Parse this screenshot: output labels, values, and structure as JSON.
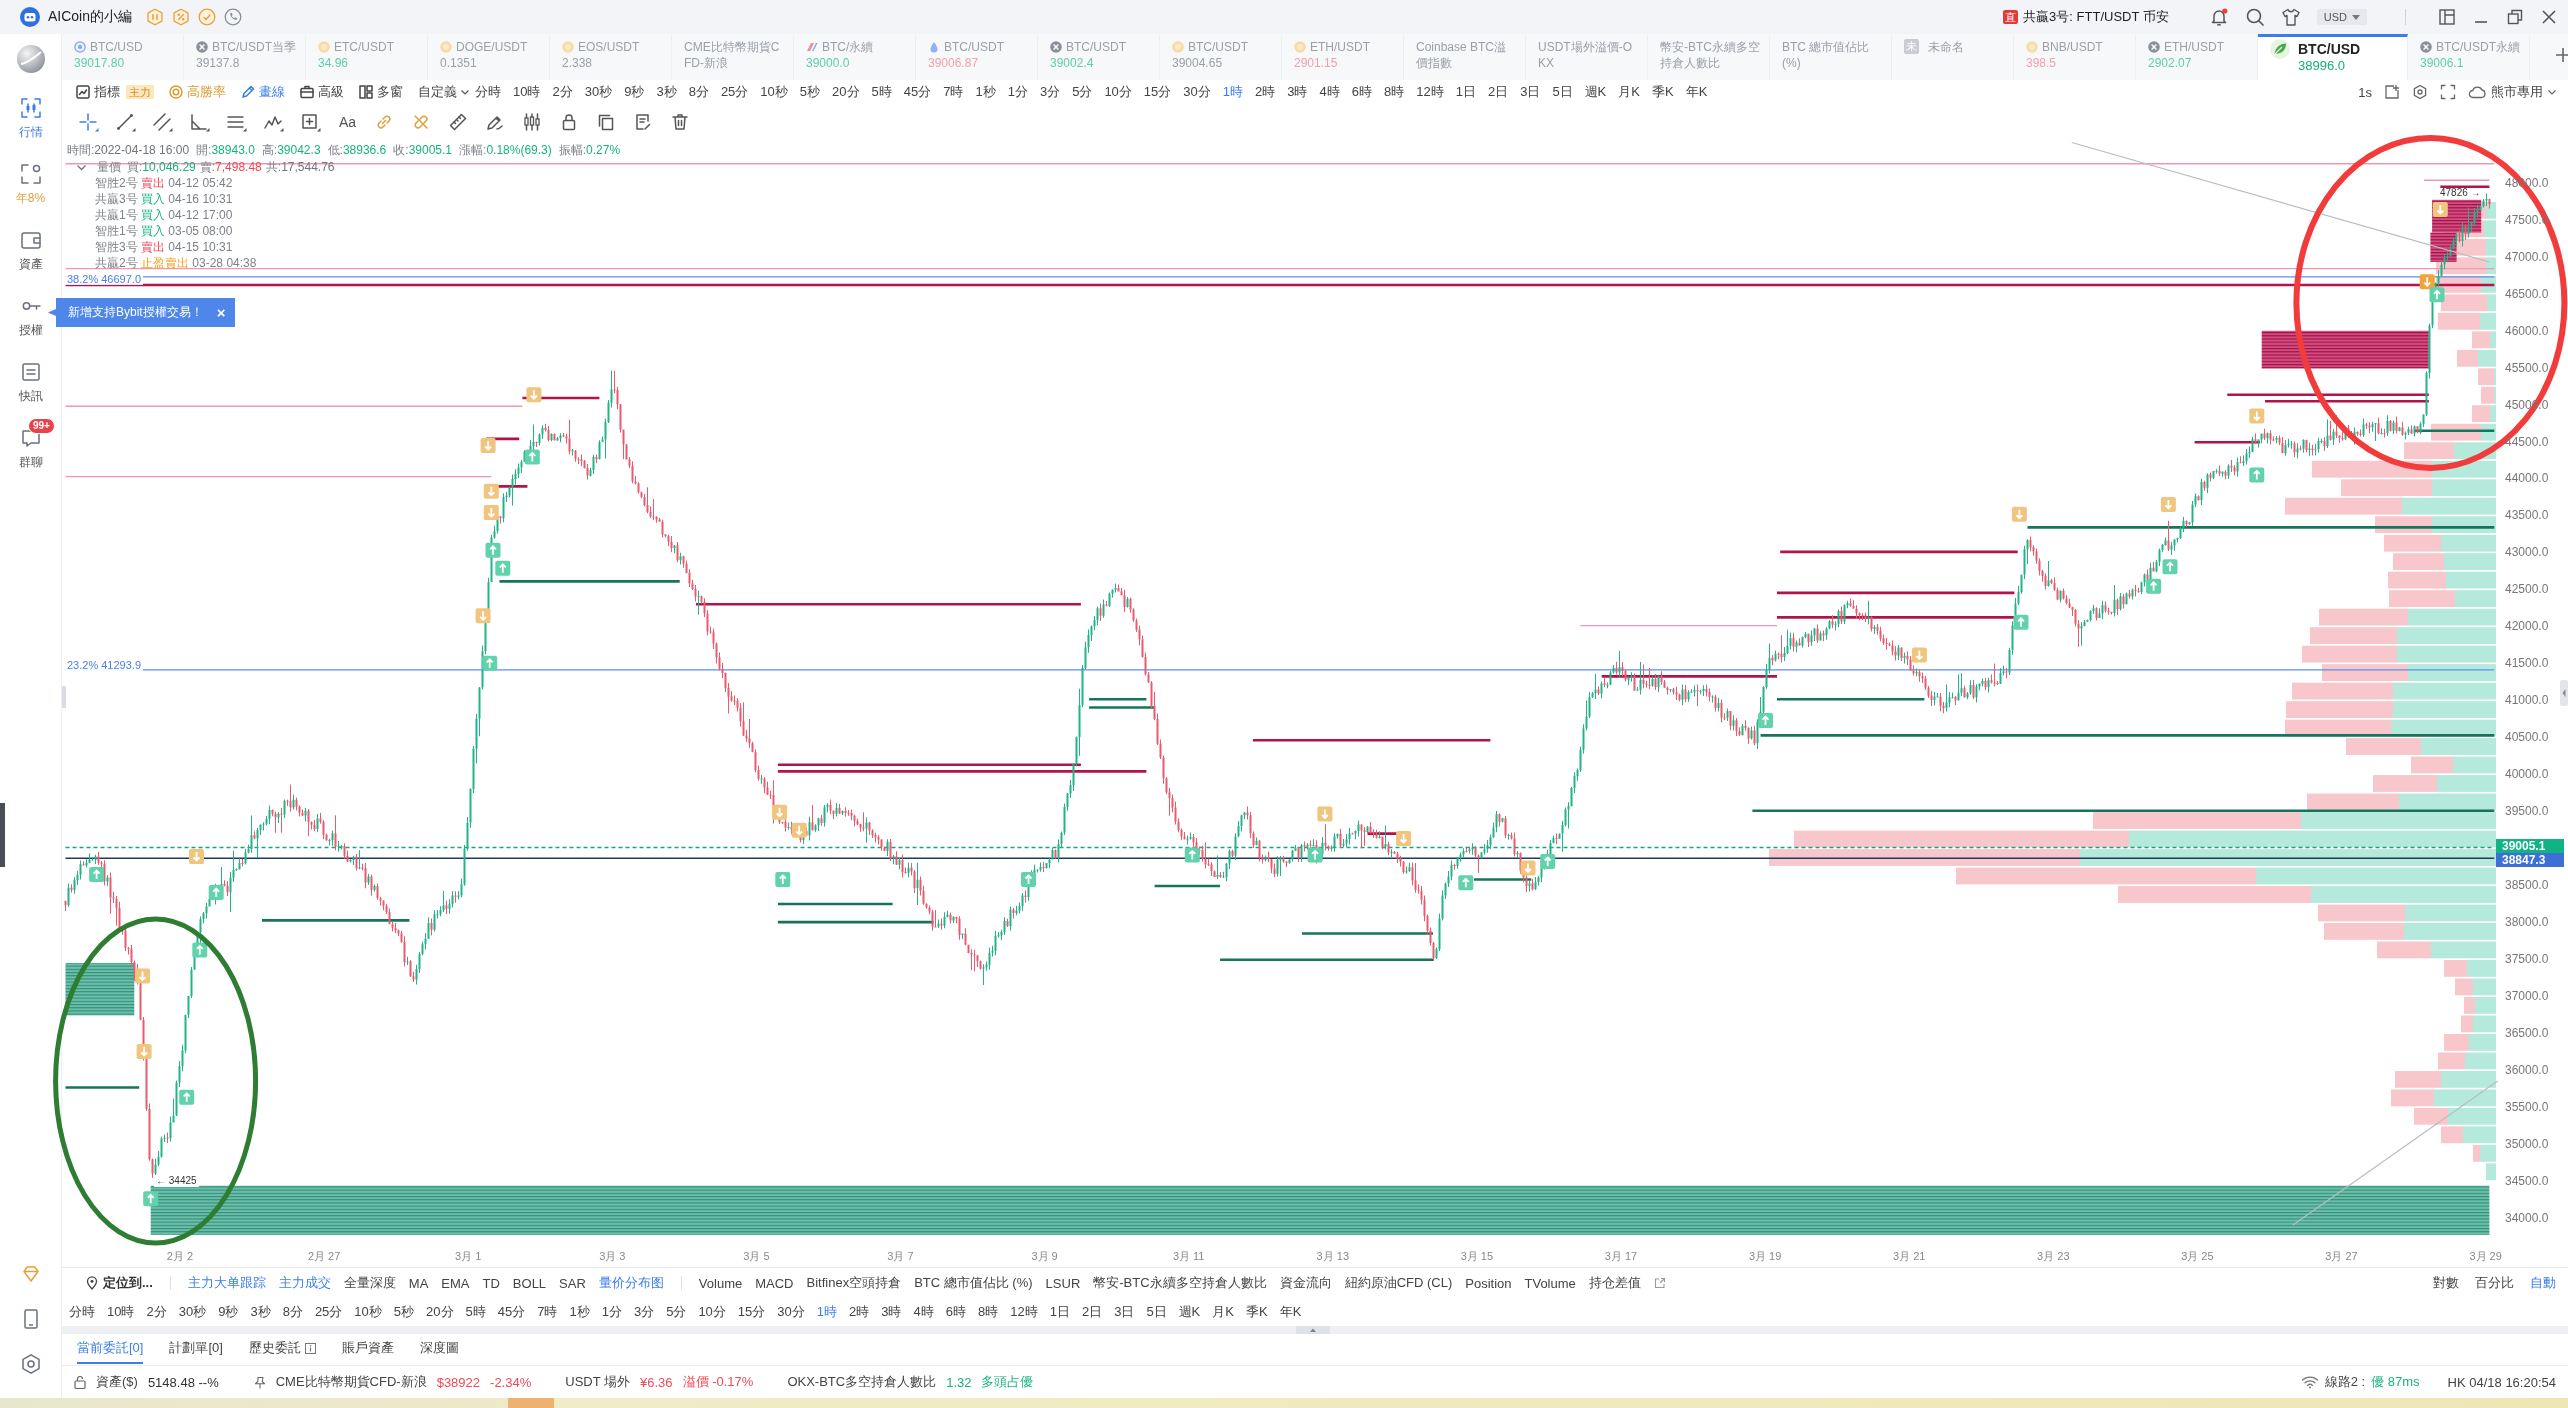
{
  "window": {
    "title": "AICoin的小編",
    "alert": {
      "tag": "直",
      "text": "共贏3号: FTT/USDT 币安"
    },
    "unread": true,
    "currency": "USD"
  },
  "sidebar": {
    "items": [
      {
        "label": "行情",
        "kind": "market",
        "selected": true
      },
      {
        "label": "年8%",
        "kind": "earn",
        "selected": false
      },
      {
        "label": "資產",
        "kind": "assets",
        "selected": false
      },
      {
        "label": "授權",
        "kind": "auth",
        "selected": false
      },
      {
        "label": "快訊",
        "kind": "news",
        "selected": false
      },
      {
        "label": "群聊",
        "kind": "chat",
        "selected": false,
        "badge": "99+"
      }
    ]
  },
  "ticker_tabs": [
    {
      "kind": "ring",
      "name": "BTC/USD",
      "price": "39017.80",
      "color": "#5ccfa6",
      "selected": false
    },
    {
      "kind": "gear",
      "name": "BTC/USDT当季",
      "price": "39137.8",
      "color": "#9a9fa8",
      "selected": false
    },
    {
      "kind": "coin",
      "name": "ETC/USDT",
      "price": "34.96",
      "color": "#5ccfa6",
      "selected": false
    },
    {
      "kind": "coin",
      "name": "DOGE/USDT",
      "price": "0.1351",
      "color": "#9a9fa8",
      "selected": false
    },
    {
      "kind": "coin",
      "name": "EOS/USDT",
      "price": "2.338",
      "color": "#9a9fa8",
      "selected": false
    },
    {
      "kind": "plain",
      "name": "CME比特幣期貨CFD-新浪",
      "selected": false
    },
    {
      "kind": "flag",
      "name": "BTC/永續",
      "price": "39000.0",
      "color": "#5ccfa6",
      "selected": false
    },
    {
      "kind": "drop",
      "name": "BTC/USDT",
      "price": "39006.87",
      "color": "#f3a0a8",
      "selected": false
    },
    {
      "kind": "gear",
      "name": "BTC/USDT",
      "price": "39002.4",
      "color": "#5ccfa6",
      "selected": false
    },
    {
      "kind": "coin",
      "name": "BTC/USDT",
      "price": "39004.65",
      "color": "#9a9fa8",
      "selected": false
    },
    {
      "kind": "coin",
      "name": "ETH/USDT",
      "price": "2901.15",
      "color": "#f3a0a8",
      "selected": false
    },
    {
      "kind": "plain",
      "name": "Coinbase BTC溢價指數",
      "selected": false
    },
    {
      "kind": "plain",
      "name": "USDT場外溢價-OKX",
      "selected": false
    },
    {
      "kind": "plain",
      "name": "幣安-BTC永續多空持倉人數比",
      "selected": false
    },
    {
      "kind": "plain",
      "name": "BTC 總市值佔比 (%)",
      "selected": false
    },
    {
      "kind": "label",
      "badge": "未",
      "name": "未命名",
      "selected": false
    },
    {
      "kind": "coin",
      "name": "BNB/USDT",
      "price": "398.5",
      "color": "#f3a0a8",
      "selected": false
    },
    {
      "kind": "gear",
      "name": "ETH/USDT",
      "price": "2902.07",
      "color": "#5ccfa6",
      "selected": false
    },
    {
      "kind": "leaf",
      "name": "BTC/USD",
      "price": "38996.0",
      "color": "#14ad7c",
      "selected": true
    },
    {
      "kind": "gear",
      "name": "BTC/USDT永續",
      "price": "39006.1",
      "color": "#5ccfa6",
      "selected": false
    }
  ],
  "toolbar": {
    "tools": [
      {
        "kind": "indicators",
        "label": "指標",
        "tag": "主力",
        "active": false
      },
      {
        "kind": "winrate",
        "label": "高勝率",
        "active": false
      },
      {
        "kind": "draw",
        "label": "畫線",
        "active": true
      },
      {
        "kind": "advanced",
        "label": "高級",
        "active": false
      },
      {
        "kind": "windows",
        "label": "多窗",
        "active": false
      },
      {
        "kind": "custom",
        "label": "自定義",
        "active": false
      }
    ],
    "intervals": [
      {
        "label": "分時",
        "selected": false
      },
      {
        "label": "10時",
        "selected": false
      },
      {
        "label": "2分",
        "selected": false
      },
      {
        "label": "30秒",
        "selected": false
      },
      {
        "label": "9秒",
        "selected": false
      },
      {
        "label": "3秒",
        "selected": false
      },
      {
        "label": "8分",
        "selected": false
      },
      {
        "label": "25分",
        "selected": false
      },
      {
        "label": "10秒",
        "selected": false
      },
      {
        "label": "5秒",
        "selected": false
      },
      {
        "label": "20分",
        "selected": false
      },
      {
        "label": "5時",
        "selected": false
      },
      {
        "label": "45分",
        "selected": false
      },
      {
        "label": "7時",
        "selected": false
      },
      {
        "label": "1秒",
        "selected": false
      },
      {
        "label": "1分",
        "selected": false
      },
      {
        "label": "3分",
        "selected": false
      },
      {
        "label": "5分",
        "selected": false
      },
      {
        "label": "10分",
        "selected": false
      },
      {
        "label": "15分",
        "selected": false
      },
      {
        "label": "30分",
        "selected": false
      },
      {
        "label": "1時",
        "selected": true
      },
      {
        "label": "2時",
        "selected": false
      },
      {
        "label": "3時",
        "selected": false
      },
      {
        "label": "4時",
        "selected": false
      },
      {
        "label": "6時",
        "selected": false
      },
      {
        "label": "8時",
        "selected": false
      },
      {
        "label": "12時",
        "selected": false
      },
      {
        "label": "1日",
        "selected": false
      },
      {
        "label": "2日",
        "selected": false
      },
      {
        "label": "3日",
        "selected": false
      },
      {
        "label": "5日",
        "selected": false
      },
      {
        "label": "週K",
        "selected": false
      },
      {
        "label": "月K",
        "selected": false
      },
      {
        "label": "季K",
        "selected": false
      },
      {
        "label": "年K",
        "selected": false
      }
    ],
    "refresh": "1s",
    "theme": "熊市專用"
  },
  "drawing_tools": [
    {
      "kind": "crosshair",
      "selected": true
    },
    {
      "kind": "segment",
      "selected": false
    },
    {
      "kind": "parallel",
      "selected": false
    },
    {
      "kind": "angle",
      "selected": false
    },
    {
      "kind": "hlines",
      "selected": false
    },
    {
      "kind": "wave",
      "selected": false
    },
    {
      "kind": "box",
      "selected": false
    },
    {
      "kind": "text",
      "label": "Aa",
      "selected": false
    },
    {
      "kind": "link",
      "selected": false
    },
    {
      "kind": "unlink",
      "selected": false
    },
    {
      "kind": "ruler",
      "selected": false
    },
    {
      "kind": "pen",
      "selected": false
    },
    {
      "kind": "candles",
      "selected": false
    },
    {
      "kind": "lock",
      "selected": false
    },
    {
      "kind": "copy",
      "selected": false
    },
    {
      "kind": "note",
      "selected": false
    },
    {
      "kind": "trash",
      "selected": false
    }
  ],
  "chart": {
    "ohlc": [
      {
        "label": "時間:",
        "value": "2022-04-18 16:00",
        "color": "#6f747d"
      },
      {
        "label": "開:",
        "value": "38943.0",
        "color": "#17b27f"
      },
      {
        "label": "高:",
        "value": "39042.3",
        "color": "#17b27f"
      },
      {
        "label": "低:",
        "value": "38936.6",
        "color": "#17b27f"
      },
      {
        "label": "收:",
        "value": "39005.1",
        "color": "#17b27f"
      },
      {
        "label": "漲幅:",
        "value": "0.18%(69.3)",
        "color": "#17b27f"
      },
      {
        "label": "振幅:",
        "value": "0.27%",
        "color": "#17b27f"
      }
    ],
    "volume": {
      "title": "量價",
      "expanded": true,
      "parts": [
        {
          "label": "買:",
          "value": "10,046.29",
          "color": "#17b27f"
        },
        {
          "label": "賣:",
          "value": "7,498.48",
          "color": "#ef4a55"
        },
        {
          "label": "共:",
          "value": "17,544.76",
          "color": "#6f747d"
        }
      ]
    },
    "trades": [
      {
        "bot": "智胜2号",
        "action": "賣出",
        "kind": "sell",
        "time": "04-12 05:42"
      },
      {
        "bot": "共贏3号",
        "action": "買入",
        "kind": "buy",
        "time": "04-16 10:31"
      },
      {
        "bot": "共贏1号",
        "action": "買入",
        "kind": "buy",
        "time": "04-12 17:00"
      },
      {
        "bot": "智胜1号",
        "action": "買入",
        "kind": "buy",
        "time": "03-05 08:00"
      },
      {
        "bot": "智胜3号",
        "action": "賣出",
        "kind": "sell",
        "time": "04-15 10:31"
      },
      {
        "bot": "共贏2号",
        "action": "止盈賣出",
        "kind": "take_profit",
        "time": "03-28 04:38"
      }
    ],
    "fib_levels": [
      "38.2% 46697.0",
      "23.2% 41293.9"
    ],
    "high_label": "47826 →",
    "low_label": "← 34425",
    "price_axis": {
      "upper": [
        "48000.0",
        "47500.0",
        "47000.0",
        "46500.0",
        "46000.0",
        "45500.0",
        "45000.0",
        "44500.0",
        "44000.0",
        "43500.0",
        "43000.0",
        "42500.0",
        "42000.0",
        "41500.0",
        "41000.0",
        "40500.0",
        "40000.0",
        "39500.0"
      ],
      "lower": [
        "38500.0",
        "38000.0",
        "37500.0",
        "37000.0",
        "36500.0",
        "36000.0",
        "35500.0",
        "35000.0",
        "34500.0",
        "34000.0"
      ]
    },
    "price_tags": [
      {
        "kind": "last",
        "value": "39005.1"
      },
      {
        "kind": "mark",
        "value": "38847.3"
      }
    ],
    "date_axis": [
      "2月 2",
      "2月 27",
      "3月 1",
      "3月 3",
      "3月 5",
      "3月 7",
      "3月 9",
      "3月 11",
      "3月 13",
      "3月 15",
      "3月 17",
      "3月 19",
      "3月 21",
      "3月 23",
      "3月 25",
      "3月 27",
      "3月 29"
    ]
  },
  "popup": {
    "text": "新增支持Bybit授權交易！",
    "close": "×"
  },
  "indicator_bar": {
    "locate": "定位到...",
    "main": [
      {
        "label": "主力大单跟踪",
        "active": true
      },
      {
        "label": "主力成交",
        "active": true
      },
      {
        "label": "全量深度",
        "active": false
      },
      {
        "label": "MA",
        "active": false
      },
      {
        "label": "EMA",
        "active": false
      },
      {
        "label": "TD",
        "active": false
      },
      {
        "label": "BOLL",
        "active": false
      },
      {
        "label": "SAR",
        "active": false
      },
      {
        "label": "量价分布图",
        "active": true
      }
    ],
    "sub": [
      {
        "label": "Volume",
        "active": false
      },
      {
        "label": "MACD",
        "active": false
      },
      {
        "label": "Bitfinex空頭持倉",
        "active": false
      },
      {
        "label": "BTC 總市值佔比 (%)",
        "active": false
      },
      {
        "label": "LSUR",
        "active": false
      },
      {
        "label": "幣安-BTC永續多空持倉人數比",
        "active": false
      },
      {
        "label": "資金流向",
        "active": false
      },
      {
        "label": "紐約原油CFD (CL)",
        "active": false
      },
      {
        "label": "Position",
        "active": false
      },
      {
        "label": "TVolume",
        "active": false
      },
      {
        "label": "持仓差值",
        "active": false
      }
    ],
    "scale_modes": [
      {
        "label": "對數",
        "selected": false
      },
      {
        "label": "百分比",
        "selected": false
      },
      {
        "label": "自動",
        "selected": true
      }
    ]
  },
  "timeframes": [
    {
      "label": "分時",
      "selected": false
    },
    {
      "label": "10時",
      "selected": false
    },
    {
      "label": "2分",
      "selected": false
    },
    {
      "label": "30秒",
      "selected": false
    },
    {
      "label": "9秒",
      "selected": false
    },
    {
      "label": "3秒",
      "selected": false
    },
    {
      "label": "8分",
      "selected": false
    },
    {
      "label": "25分",
      "selected": false
    },
    {
      "label": "10秒",
      "selected": false
    },
    {
      "label": "5秒",
      "selected": false
    },
    {
      "label": "20分",
      "selected": false
    },
    {
      "label": "5時",
      "selected": false
    },
    {
      "label": "45分",
      "selected": false
    },
    {
      "label": "7時",
      "selected": false
    },
    {
      "label": "1秒",
      "selected": false
    },
    {
      "label": "1分",
      "selected": false
    },
    {
      "label": "3分",
      "selected": false
    },
    {
      "label": "5分",
      "selected": false
    },
    {
      "label": "10分",
      "selected": false
    },
    {
      "label": "15分",
      "selected": false
    },
    {
      "label": "30分",
      "selected": false
    },
    {
      "label": "1時",
      "selected": true
    },
    {
      "label": "2時",
      "selected": false
    },
    {
      "label": "3時",
      "selected": false
    },
    {
      "label": "4時",
      "selected": false
    },
    {
      "label": "6時",
      "selected": false
    },
    {
      "label": "8時",
      "selected": false
    },
    {
      "label": "12時",
      "selected": false
    },
    {
      "label": "1日",
      "selected": false
    },
    {
      "label": "2日",
      "selected": false
    },
    {
      "label": "3日",
      "selected": false
    },
    {
      "label": "5日",
      "selected": false
    },
    {
      "label": "週K",
      "selected": false
    },
    {
      "label": "月K",
      "selected": false
    },
    {
      "label": "季K",
      "selected": false
    },
    {
      "label": "年K",
      "selected": false
    }
  ],
  "order_tabs": [
    {
      "label": "當前委託[0]",
      "selected": true,
      "info": false
    },
    {
      "label": "計劃單[0]",
      "selected": false,
      "info": false
    },
    {
      "label": "歷史委託",
      "selected": false,
      "info": true
    },
    {
      "label": "賬戶資產",
      "selected": false,
      "info": false
    },
    {
      "label": "深度圖",
      "selected": false,
      "info": false
    }
  ],
  "status_bar": {
    "assets": {
      "label": "資產($)",
      "value": "5148.48 --%"
    },
    "tickers": [
      {
        "name": "CME比特幣期貨CFD-新浪",
        "price": "$38922",
        "change": "-2.34%",
        "color": "#ef4a55",
        "pinned": true
      },
      {
        "name": "USDT 場外",
        "price": "¥6.36",
        "change": "溢價 -0.17%",
        "color": "#ef4a55",
        "pinned": false
      },
      {
        "name": "OKX-BTC多空持倉人數比",
        "price": "1.32",
        "change": "多頭占優",
        "color": "#17b27f",
        "pinned": false
      }
    ],
    "connection": {
      "label": "線路2 :",
      "quality": "優 87ms"
    },
    "clock": "HK 04/18 16:20:54"
  }
}
